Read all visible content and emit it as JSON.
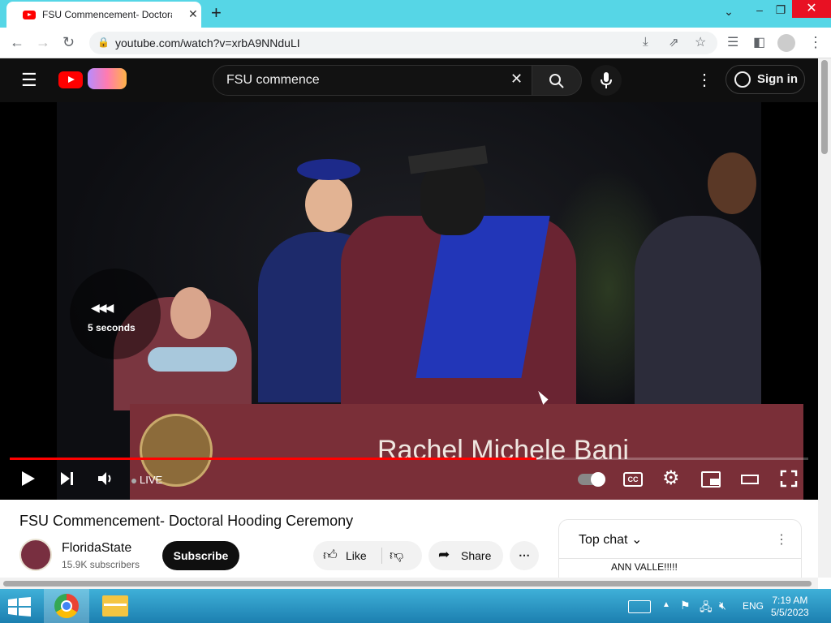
{
  "browser": {
    "tab_title": "FSU Commencement- Doctoral H",
    "url": "youtube.com/watch?v=xrbA9NNduLI"
  },
  "youtube": {
    "search_value": "FSU commence",
    "sign_in": "Sign in"
  },
  "video": {
    "caption_name": "Rachel Michele Bani",
    "seek_hint": "5 seconds",
    "live_label": "LIVE",
    "progress_fraction": 0.66
  },
  "details": {
    "title": "FSU Commencement- Doctoral Hooding Ceremony",
    "channel_name": "FloridaState",
    "subscribers": "15.9K subscribers",
    "subscribe_label": "Subscribe",
    "like_label": "Like",
    "share_label": "Share"
  },
  "chat": {
    "header": "Top chat",
    "first_message": "ANN VALLE!!!!!"
  },
  "taskbar": {
    "language": "ENG",
    "time": "7:19 AM",
    "date": "5/5/2023"
  },
  "colors": {
    "chrome_tabstrip": "#56d6e6",
    "youtube_red": "#ff0000",
    "banner_garnet": "#7a2f38"
  }
}
